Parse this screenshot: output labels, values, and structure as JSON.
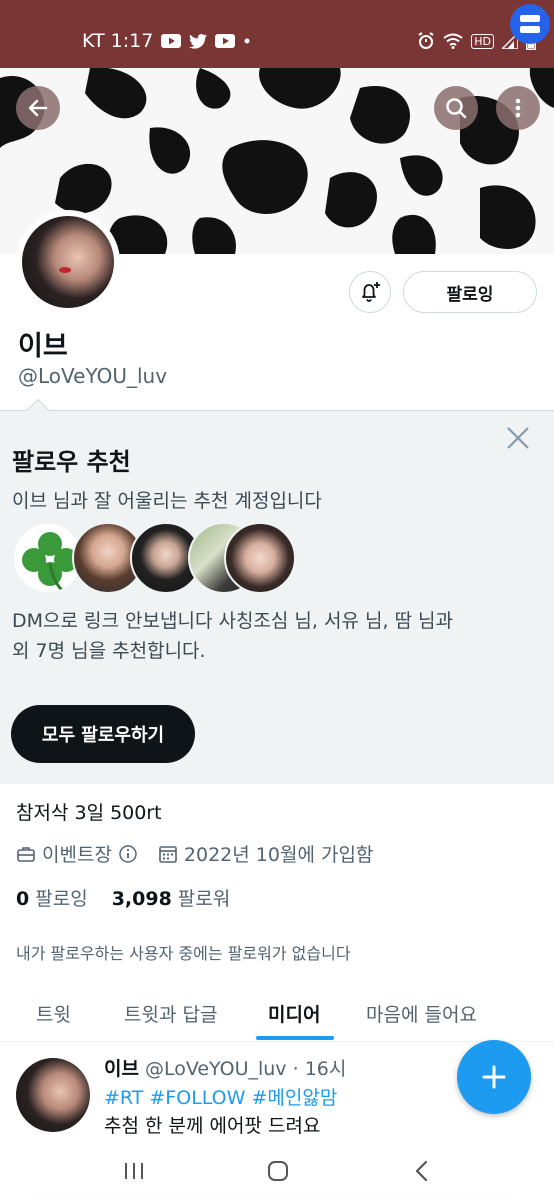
{
  "status_bar": {
    "carrier_time": "KT 1:17",
    "notification_icons": [
      "youtube-icon",
      "twitter-icon",
      "youtube-icon",
      "dot-icon"
    ],
    "right_icons": [
      "alarm-icon",
      "wifi-icon",
      "hd-icon",
      "signal-icon",
      "battery-icon"
    ],
    "hd_label": "HD",
    "background": "#7a3535"
  },
  "banner": {
    "pattern": "cow-print",
    "back_icon": "back-arrow-icon",
    "search_icon": "search-icon",
    "more_icon": "more-vertical-icon"
  },
  "profile": {
    "name": "이브",
    "handle": "@LoVeYOU_luv",
    "follow_button": "팔로잉",
    "bio": "참저삭 3일 500rt",
    "category": "이벤트장",
    "joined": "2022년 10월에 가입함",
    "following_count": "0",
    "following_label": "팔로잉",
    "followers_count": "3,098",
    "followers_label": "팔로워",
    "followers_note": "내가 팔로우하는 사용자 중에는 팔로워가 없습니다"
  },
  "recommendations": {
    "title": "팔로우 추천",
    "subtitle": "이브 님과 잘 어울리는 추천 계정입니다",
    "description_line1": "DM으로 링크 안보냅니다 사칭조심 님, 서유 님, 땀 님과",
    "description_line2": "외 7명 님을 추천합니다.",
    "follow_all_button": "모두 팔로우하기"
  },
  "tabs": [
    {
      "label": "트윗"
    },
    {
      "label": "트윗과 답글"
    },
    {
      "label": "미디어"
    },
    {
      "label": "마음에 들어요"
    }
  ],
  "active_tab": "미디어",
  "tweet": {
    "name": "이브",
    "handle": "@LoVeYOU_luv",
    "separator": "·",
    "time": "16시",
    "hashtags": "#RT #FOLLOW #메인앓맘",
    "text": "추첨 한 분께 에어팟 드려요"
  },
  "colors": {
    "accent": "#1d9bf0",
    "text": "#0f1419",
    "muted": "#536471",
    "panel": "#eff3f4"
  }
}
